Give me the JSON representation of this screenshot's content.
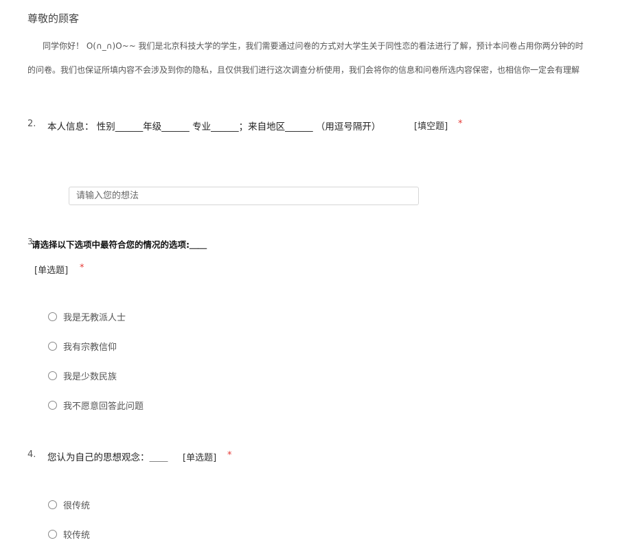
{
  "header": {
    "greeting": "尊敬的顾客"
  },
  "intro": {
    "line1": "同学你好！ O(∩_∩)O~~ 我们是北京科技大学的学生，我们需要通过问卷的方式对大学生关于同性恋的看法进行了解，预计本问卷占用你两分钟的时",
    "line2": "的问卷。我们也保证所填内容不会涉及到你的隐私，且仅供我们进行这次调查分析使用，我们会将你的信息和问卷所选内容保密，也相信你一定会有理解"
  },
  "question2": {
    "number": "2.",
    "text": "本人信息：  性别______年级______ 专业______；来自地区______      （用逗号隔开）",
    "type": "[填空题]",
    "required": "*",
    "input_placeholder": "请输入您的想法",
    "input_value": ""
  },
  "question3": {
    "number": "3",
    "text": "请选择以下选项中最符合您的情况的选项:＿＿",
    "type": "[单选题]",
    "required": "*",
    "options": [
      "我是无教派人士",
      "我有宗教信仰",
      "我是少数民族",
      "我不愿意回答此问题"
    ]
  },
  "question4": {
    "number": "4.",
    "text": "您认为自己的思想观念：＿＿",
    "type": "[单选题]",
    "required": "*",
    "options": [
      "很传统",
      "较传统"
    ]
  },
  "colors": {
    "required_mark": "#e53935",
    "input_border": "#d6d6d6"
  }
}
